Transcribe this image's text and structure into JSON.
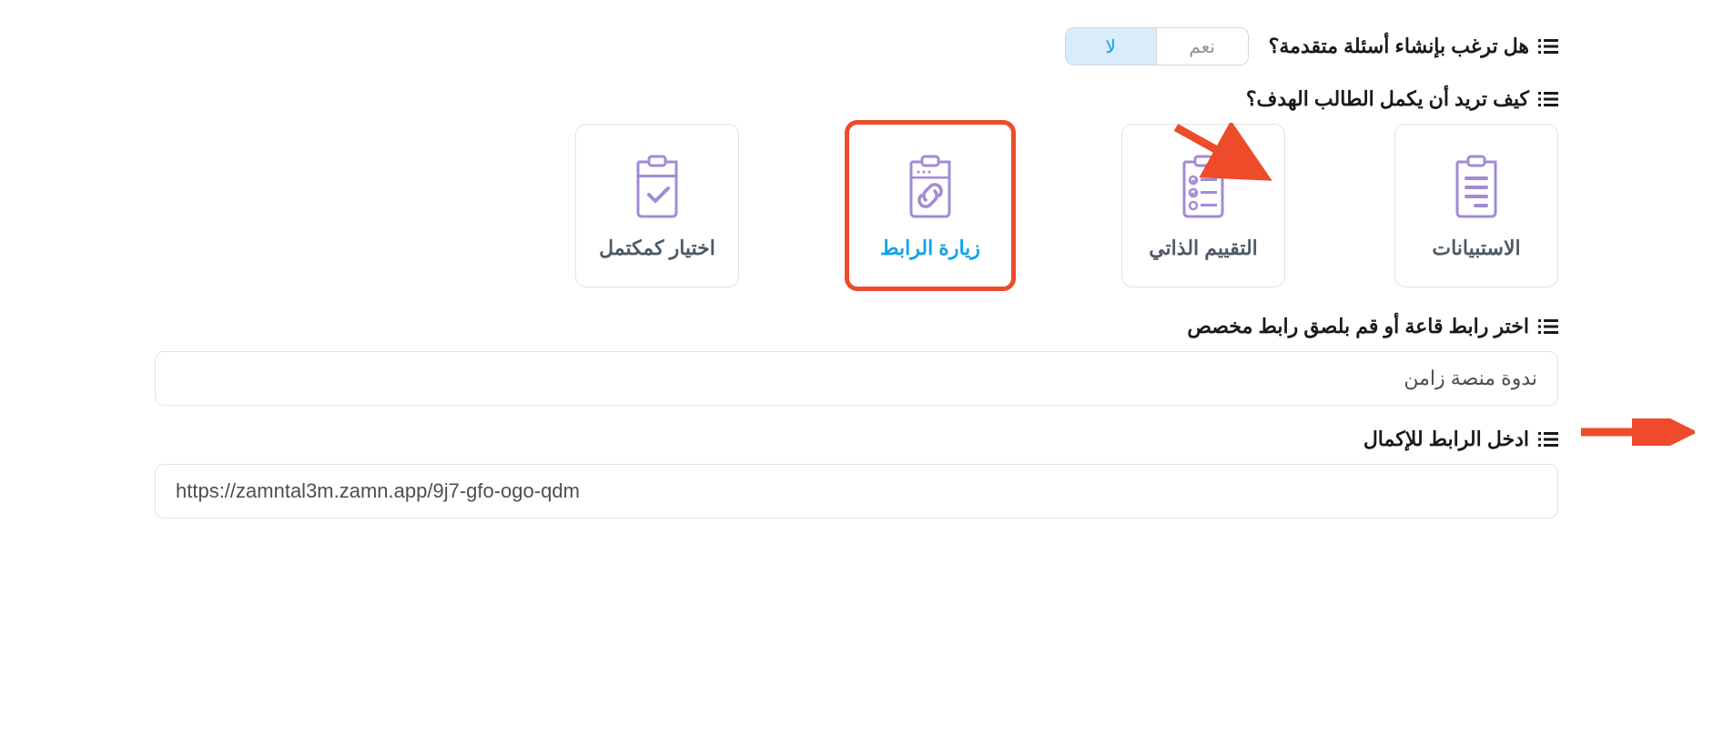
{
  "question_advanced": {
    "label": "هل ترغب بإنشاء أسئلة متقدمة؟",
    "yes": "نعم",
    "no": "لا",
    "selected": "no"
  },
  "completion_method": {
    "label": "كيف تريد أن يكمل الطالب الهدف؟",
    "options": [
      {
        "key": "mark_complete",
        "label": "اختيار كمكتمل"
      },
      {
        "key": "visit_link",
        "label": "زيارة الرابط",
        "selected": true
      },
      {
        "key": "self_assess",
        "label": "التقييم الذاتي"
      },
      {
        "key": "surveys",
        "label": "الاستبيانات"
      }
    ]
  },
  "link_select": {
    "label": "اختر رابط قاعة أو قم بلصق رابط مخصص",
    "value": "ندوة منصة زامن"
  },
  "link_enter": {
    "label": "ادخل الرابط للإكمال",
    "value": "https://zamntal3m.zamn.app/9j7-gfo-ogo-qdm"
  },
  "colors": {
    "accent": "#0ea5e9",
    "highlight": "#ee4b2b",
    "iconPurple": "#a28bd4"
  }
}
